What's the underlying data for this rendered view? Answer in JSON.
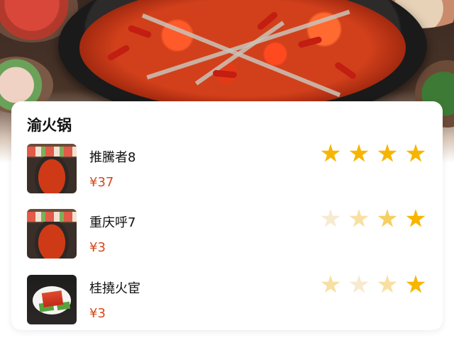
{
  "hero": {
    "image": "hotpot-photo"
  },
  "card": {
    "title": "渝火锅",
    "items": [
      {
        "name": "推騰者8",
        "price": "¥37",
        "thumb": "hotpot-thumbnail",
        "rating_stars_full": 4
      },
      {
        "name": "重庆呼7",
        "price": "¥3",
        "thumb": "hotpot-thumbnail",
        "rating_stars_full": 1
      },
      {
        "name": "桂撓火宦",
        "price": "¥3",
        "thumb": "sliced-pork-thumbnail",
        "rating_stars_full": 1
      }
    ]
  },
  "colors": {
    "price": "#d6481a",
    "star": "#f7b500"
  }
}
